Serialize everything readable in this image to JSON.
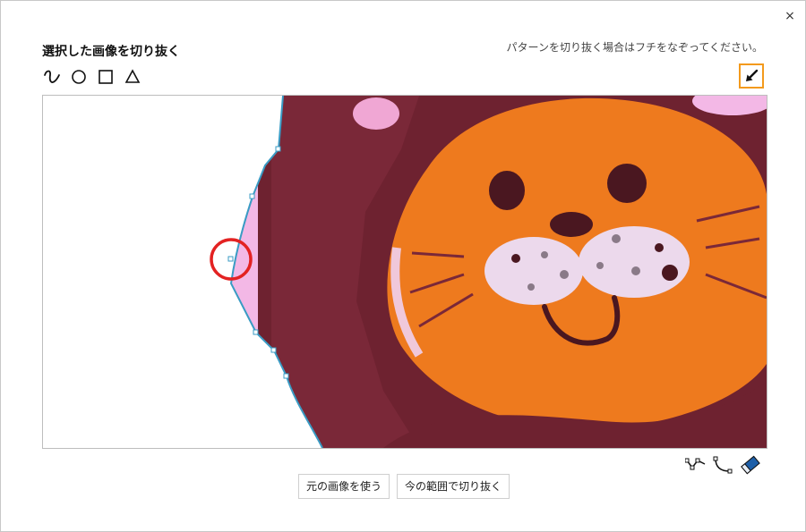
{
  "dialog": {
    "title": "選択した画像を切り抜く",
    "instruction": "パターンを切り抜く場合はフチをなぞってください。",
    "close_label": "×"
  },
  "tools": [
    {
      "name": "freehand",
      "icon": "freehand-curve-icon"
    },
    {
      "name": "circle",
      "icon": "circle-icon"
    },
    {
      "name": "square",
      "icon": "square-icon"
    },
    {
      "name": "triangle",
      "icon": "triangle-icon"
    }
  ],
  "arrow_tool": {
    "icon": "arrow-down-left-icon",
    "accent": "#f39a1d"
  },
  "edit_tools": [
    {
      "name": "node-edit-1",
      "icon": "node-edit-icon"
    },
    {
      "name": "node-edit-2",
      "icon": "curve-node-icon"
    },
    {
      "name": "eraser",
      "icon": "eraser-icon",
      "color": "#1e5fa8"
    }
  ],
  "buttons": {
    "use_original": "元の画像を使う",
    "crop_current": "今の範囲で切り抜く"
  },
  "colors": {
    "selection_line": "#3a9bc4",
    "selection_fill": "#f3b8e6",
    "highlight_ring": "#e32222",
    "face_orange": "#ee7a1e",
    "mane_dark": "#6e2230"
  }
}
